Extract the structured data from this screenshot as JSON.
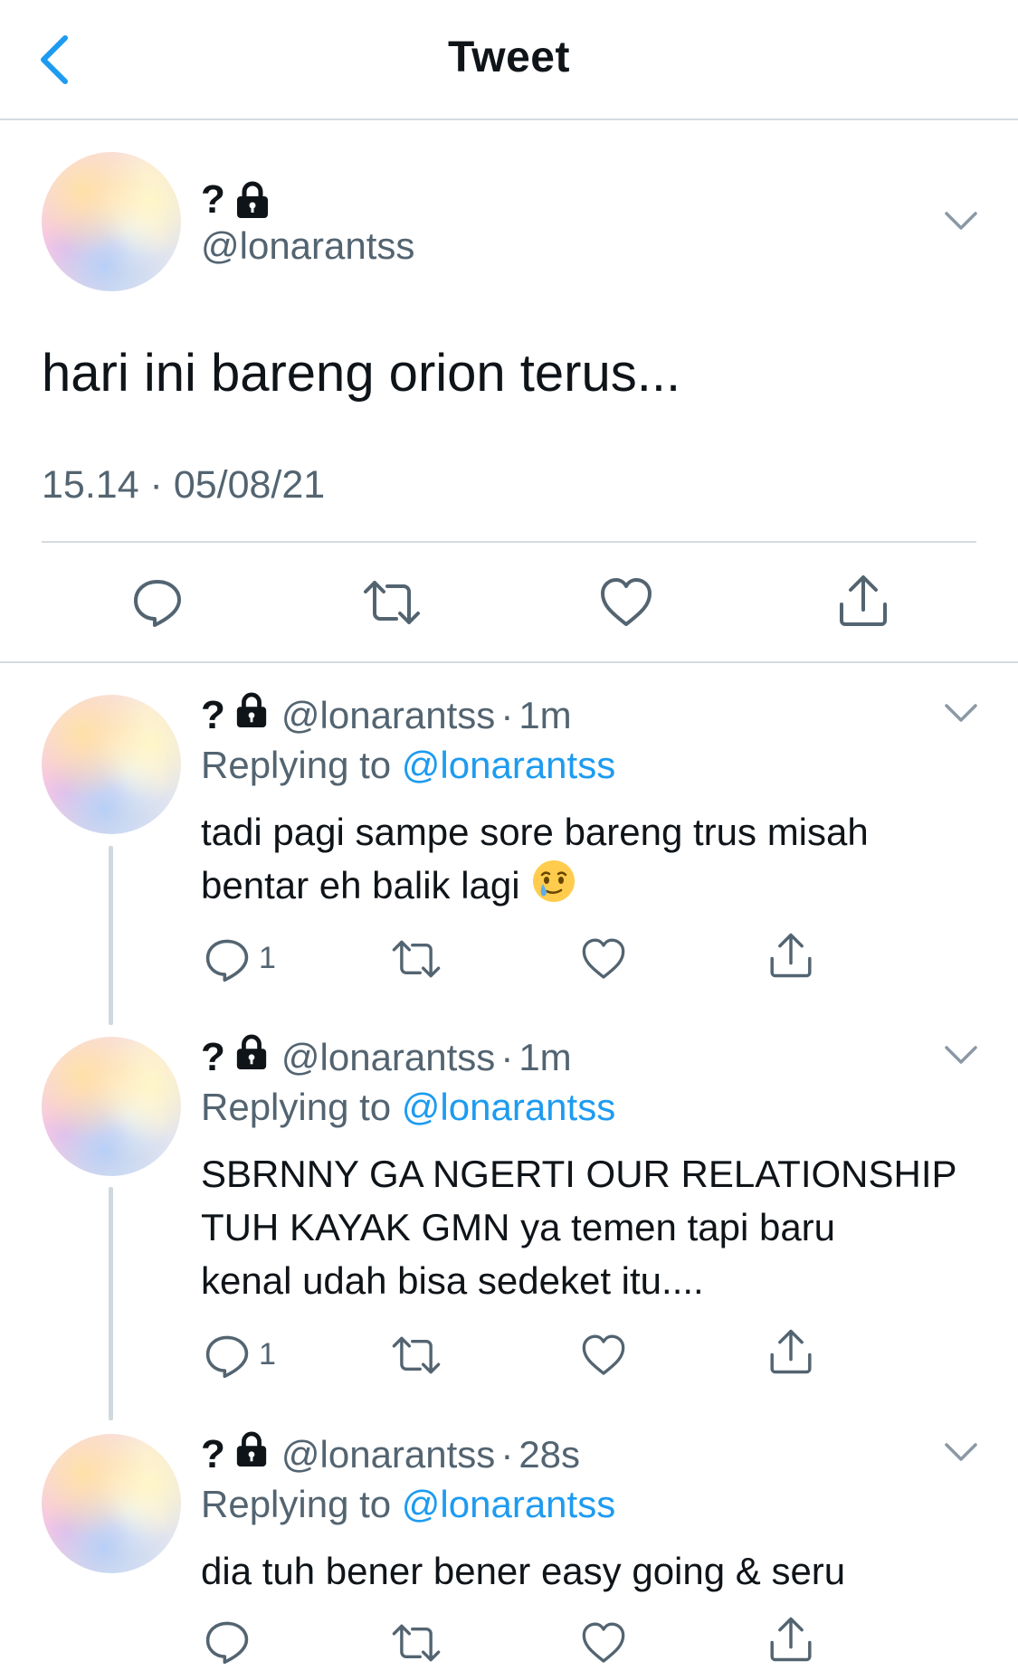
{
  "header": {
    "title": "Tweet",
    "back_icon": "chevron-left-icon",
    "accent": "#1d9bf0"
  },
  "main_tweet": {
    "name": "?",
    "name_icon": "lock-icon",
    "handle": "@lonarantss",
    "text": "hari ini bareng orion terus...",
    "timestamp": "15.14 · 05/08/21",
    "actions": [
      "reply-icon",
      "retweet-icon",
      "like-icon",
      "share-icon"
    ]
  },
  "replies": [
    {
      "name": "?",
      "handle": "@lonarantss",
      "separator": "·",
      "time": "1m",
      "replying_label": "Replying to",
      "replying_to": "@lonarantss",
      "text_lines": [
        "tadi pagi sampe sore bareng trus misah",
        "bentar eh balik lagi"
      ],
      "emoji": "face-holding-back-tears",
      "reply_count": "1"
    },
    {
      "name": "?",
      "handle": "@lonarantss",
      "separator": "·",
      "time": "1m",
      "replying_label": "Replying to",
      "replying_to": "@lonarantss",
      "text_lines": [
        "SBRNNY GA NGERTI OUR RELATIONSHIP",
        "TUH KAYAK GMN ya temen tapi baru",
        "kenal udah bisa sedeket itu...."
      ],
      "reply_count": "1"
    },
    {
      "name": "?",
      "handle": "@lonarantss",
      "separator": "·",
      "time": "28s",
      "replying_label": "Replying to",
      "replying_to": "@lonarantss",
      "text_lines": [
        "dia tuh bener bener easy going & seru"
      ],
      "reply_count": ""
    }
  ]
}
